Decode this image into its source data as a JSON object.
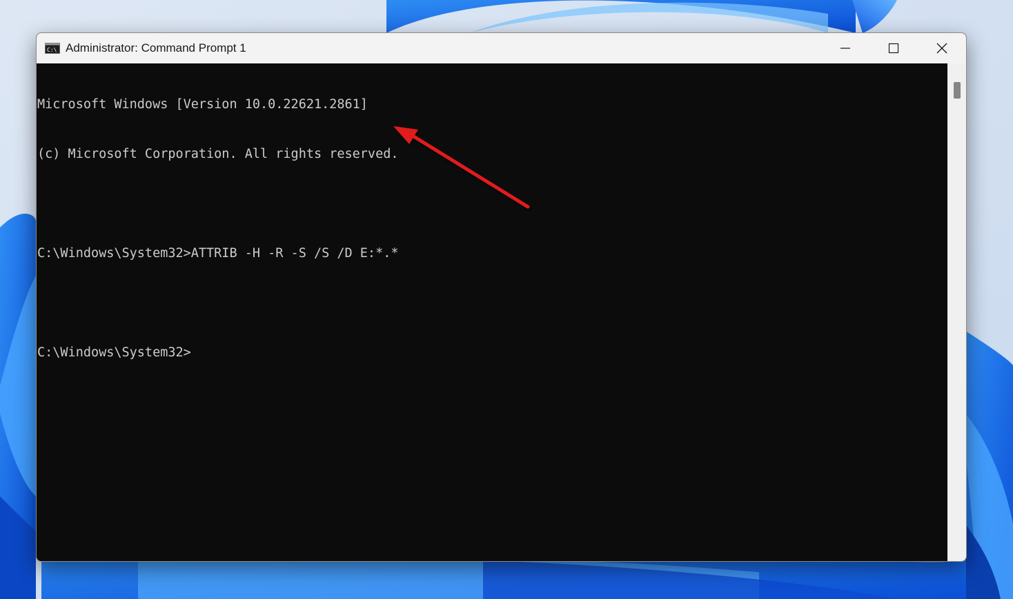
{
  "window": {
    "title": "Administrator: Command Prompt 1",
    "icon": "cmd-icon",
    "controls": {
      "minimize": "minimize-icon",
      "maximize": "maximize-icon",
      "close": "close-icon"
    }
  },
  "console": {
    "lines": [
      "Microsoft Windows [Version 10.0.22621.2861]",
      "(c) Microsoft Corporation. All rights reserved.",
      "",
      "C:\\Windows\\System32>ATTRIB -H -R -S /S /D E:*.*",
      "",
      "C:\\Windows\\System32>"
    ]
  },
  "colors": {
    "console_bg": "#0c0c0c",
    "console_text": "#cccccc",
    "titlebar_bg": "#f3f3f3",
    "annotation_arrow": "#e01b1b"
  }
}
